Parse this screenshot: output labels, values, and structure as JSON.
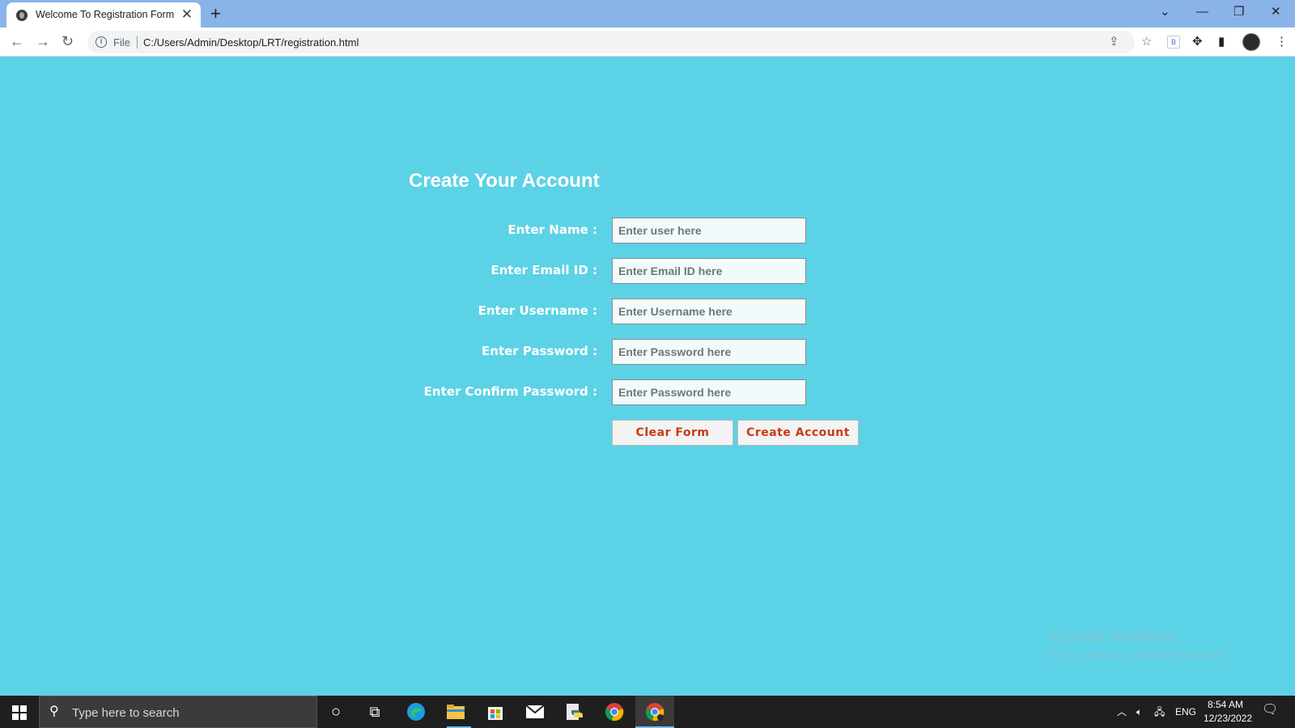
{
  "browser": {
    "tab_title": "Welcome To Registration Form",
    "tab_close": "✕",
    "new_tab": "+",
    "file_label": "File",
    "url": "C:/Users/Admin/Desktop/LRT/registration.html",
    "extension_label": "B"
  },
  "form": {
    "title": "Create Your Account",
    "fields": [
      {
        "label": "Enter Name :",
        "placeholder": "Enter user here",
        "value": ""
      },
      {
        "label": "Enter Email ID :",
        "placeholder": "Enter Email ID here",
        "value": ""
      },
      {
        "label": "Enter Username :",
        "placeholder": "Enter Username here",
        "value": ""
      },
      {
        "label": "Enter Password :",
        "placeholder": "Enter Password here",
        "value": ""
      },
      {
        "label": "Enter Confirm Password :",
        "placeholder": "Enter Password here",
        "value": ""
      }
    ],
    "clear_button": "Clear Form",
    "create_button": "Create Account",
    "accent_color": "#c83a14",
    "background_color": "#5cd2e6"
  },
  "watermark": {
    "title": "Activate Windows",
    "subtitle": "Go to Settings to activate Windows."
  },
  "taskbar": {
    "search_placeholder": "Type here to search",
    "language": "ENG",
    "time": "8:54 AM",
    "date": "12/23/2022",
    "apps": [
      "cortana-icon",
      "task-view-icon",
      "edge-icon",
      "file-explorer-icon",
      "store-icon",
      "mail-icon",
      "python-icon",
      "chrome-icon",
      "chrome-active-icon"
    ]
  }
}
